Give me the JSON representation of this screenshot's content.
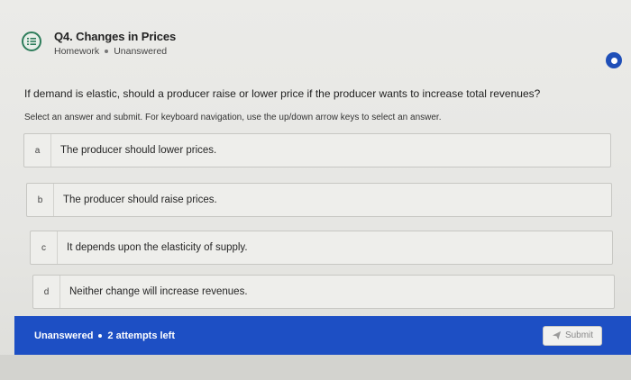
{
  "header": {
    "icon": "list-icon",
    "title": "Q4. Changes in Prices",
    "category": "Homework",
    "status": "Unanswered"
  },
  "question": {
    "text": "If demand is elastic, should a producer raise or lower price if the producer wants to increase total revenues?",
    "instructions": "Select an answer and submit. For keyboard navigation, use the up/down arrow keys to select an answer."
  },
  "options": [
    {
      "letter": "a",
      "text": "The producer should lower prices."
    },
    {
      "letter": "b",
      "text": "The producer should raise prices."
    },
    {
      "letter": "c",
      "text": "It depends upon the elasticity of supply."
    },
    {
      "letter": "d",
      "text": "Neither change will increase revenues."
    }
  ],
  "footer": {
    "status": "Unanswered",
    "attempts": "2 attempts left",
    "submit_label": "Submit",
    "submit_icon": "send-icon"
  },
  "colors": {
    "accent": "#1d4fc4",
    "icon_green": "#2e7d5b"
  }
}
